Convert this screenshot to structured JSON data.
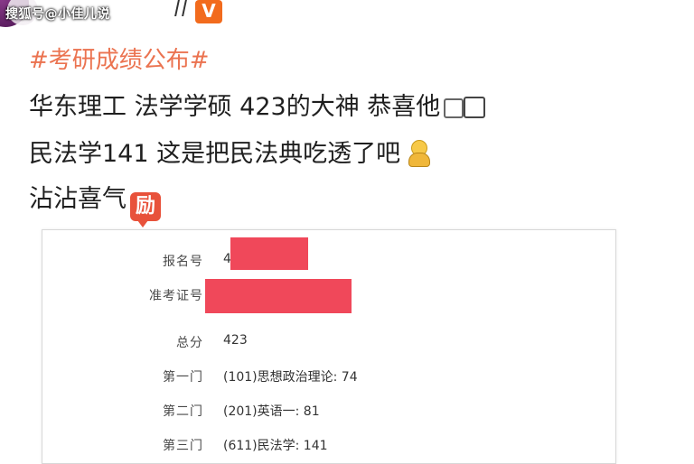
{
  "watermark": "搜狐号@小佳儿说",
  "badge_letter": "V",
  "post": {
    "hashtag": "#考研成绩公布#",
    "line1": "华东理工 法学学硕 423的大神 恭喜他",
    "line2": "民法学141 这是把民法典吃透了吧",
    "line3": "沾沾喜气",
    "emoji_li": "励"
  },
  "document": {
    "rows": [
      {
        "label": "报名号",
        "value": "4"
      },
      {
        "label": "准考证号",
        "value": ""
      },
      {
        "label": "总分",
        "value": "423"
      },
      {
        "label": "第一门",
        "value": "(101)思想政治理论:  74"
      },
      {
        "label": "第二门",
        "value": "(201)英语一:  81"
      },
      {
        "label": "第三门",
        "value": "(611)民法学:  141"
      }
    ]
  },
  "colors": {
    "hashtag": "#eb7350",
    "redaction": "#f0485a",
    "badge": "#f26b1d"
  }
}
